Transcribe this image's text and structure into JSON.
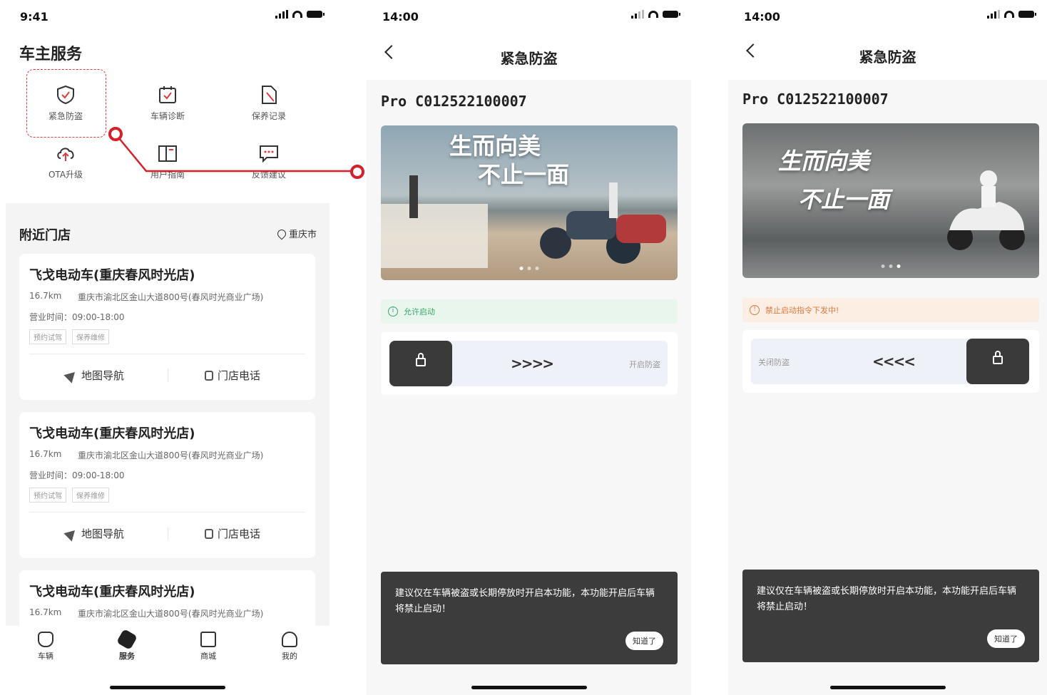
{
  "screen_service": {
    "status_time": "9:41",
    "title": "车主服务",
    "services": [
      {
        "label": "紧急防盗",
        "icon": "shield-check-icon"
      },
      {
        "label": "车辆诊断",
        "icon": "calendar-check-icon"
      },
      {
        "label": "保养记录",
        "icon": "document-icon"
      },
      {
        "label": "OTA升级",
        "icon": "cloud-upload-icon"
      },
      {
        "label": "用户指南",
        "icon": "book-icon"
      },
      {
        "label": "反馈建议",
        "icon": "chat-bubble-icon"
      }
    ],
    "nearby_title": "附近门店",
    "city": "重庆市",
    "stores": [
      {
        "name": "飞戈电动车(重庆春风时光店)",
        "distance": "16.7km",
        "address": "重庆市渝北区金山大道800号(春风时光商业广场)",
        "hours": "营业时间：09:00-18:00",
        "tags": [
          "预约试驾",
          "保养维修"
        ],
        "nav_label": "地图导航",
        "tel_label": "门店电话"
      },
      {
        "name": "飞戈电动车(重庆春风时光店)",
        "distance": "16.7km",
        "address": "重庆市渝北区金山大道800号(春风时光商业广场)",
        "hours": "营业时间：09:00-18:00",
        "tags": [
          "预约试驾",
          "保养维修"
        ],
        "nav_label": "地图导航",
        "tel_label": "门店电话"
      },
      {
        "name": "飞戈电动车(重庆春风时光店)",
        "distance": "16.7km",
        "address": "重庆市渝北区金山大道800号(春风时光商业广场)"
      }
    ],
    "tabs": [
      {
        "label": "车辆",
        "icon": "scooter-icon"
      },
      {
        "label": "服务",
        "icon": "hexagon-icon",
        "active": true
      },
      {
        "label": "商城",
        "icon": "shop-bag-icon"
      },
      {
        "label": "我的",
        "icon": "user-icon"
      }
    ]
  },
  "screen_enable": {
    "status_time": "14:00",
    "title": "紧急防盗",
    "vehicle_id": "Pro  C012522100007",
    "banner_line1": "生而向美",
    "banner_line2": "不止一面",
    "notice": "允许启动",
    "notice_color": "#e9f6ee",
    "notice_text_color": "#3aa86a",
    "chevrons": ">>>>",
    "slide_label": "开启防盗",
    "dialog_text": "建议仅在车辆被盗或长期停放时开启本功能，本功能开启后车辆将禁止启动！",
    "dialog_button": "知道了"
  },
  "screen_disable": {
    "status_time": "14:00",
    "title": "紧急防盗",
    "vehicle_id": "Pro  C012522100007",
    "banner_line1": "生而向美",
    "banner_line2": "不止一面",
    "notice": "禁止启动指令下发中!",
    "notice_color": "#fdeee4",
    "notice_text_color": "#e07a3f",
    "chevrons": "<<<<",
    "slide_label": "关闭防盗",
    "dialog_text": "建议仅在车辆被盗或长期停放时开启本功能，本功能开启后车辆将禁止启动！",
    "dialog_button": "知道了"
  }
}
